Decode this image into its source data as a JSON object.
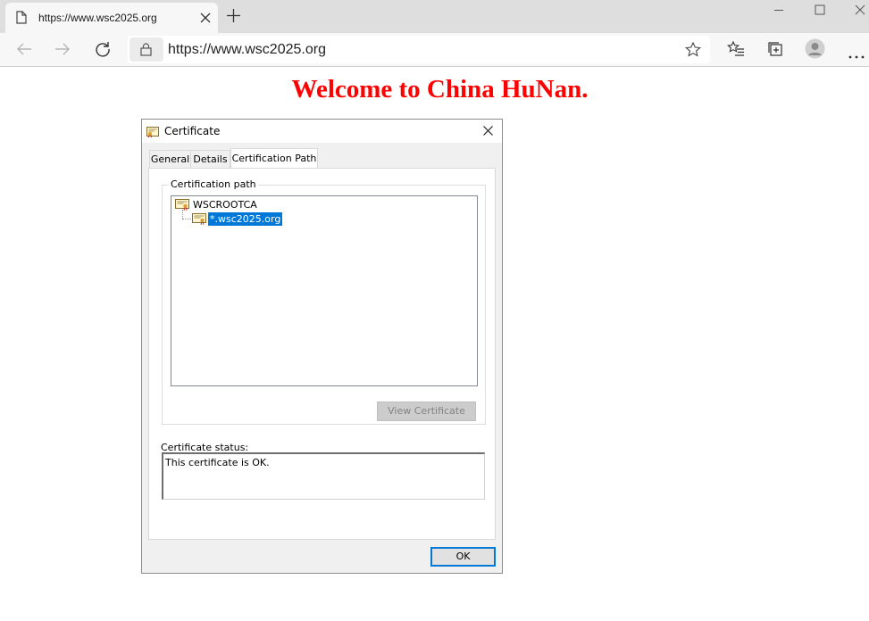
{
  "browser": {
    "tab_title": "https://www.wsc2025.org",
    "address": "https://www.wsc2025.org"
  },
  "page": {
    "heading": "Welcome to China HuNan."
  },
  "dialog": {
    "title": "Certificate",
    "tabs": [
      "General",
      "Details",
      "Certification Path"
    ],
    "active_tab": "Certification Path",
    "group_label": "Certification path",
    "tree": [
      {
        "label": "WSCROOTCA",
        "level": 0,
        "selected": false
      },
      {
        "label": "*.wsc2025.org",
        "level": 1,
        "selected": true
      }
    ],
    "view_button": "View Certificate",
    "status_label": "Certificate status:",
    "status_text": "This certificate is OK.",
    "ok_button": "OK"
  },
  "colors": {
    "heading": "#ff0000",
    "selection": "#0078d7"
  }
}
